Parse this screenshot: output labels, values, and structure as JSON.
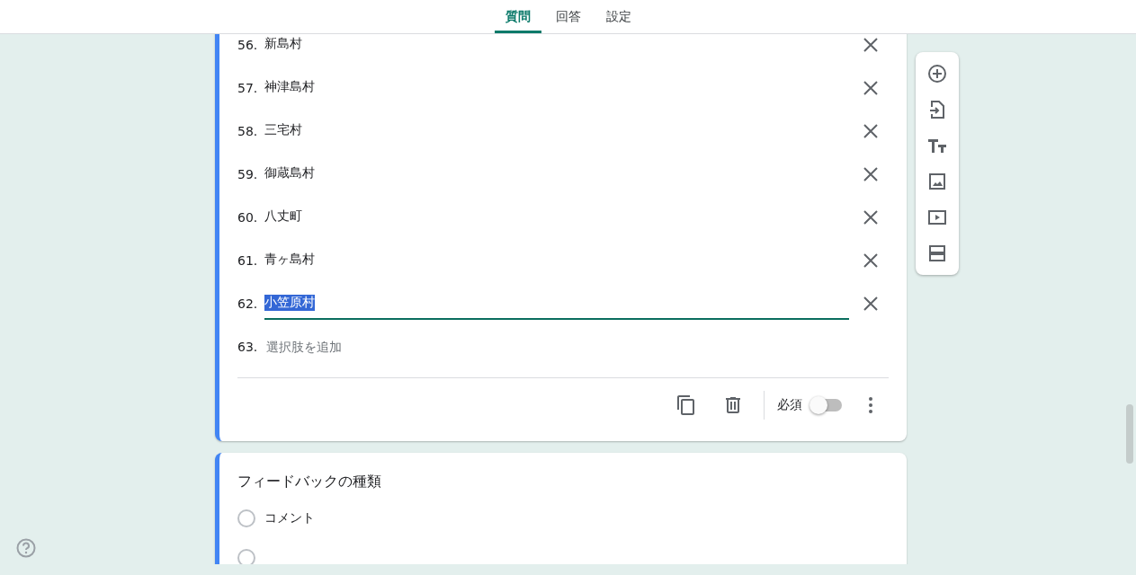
{
  "tabs": [
    {
      "label": "質問",
      "selected": true
    },
    {
      "label": "回答",
      "selected": false
    },
    {
      "label": "設定",
      "selected": false
    }
  ],
  "question": {
    "options": [
      {
        "number": "56.",
        "text": "新島村",
        "editing": false
      },
      {
        "number": "57.",
        "text": "神津島村",
        "editing": false
      },
      {
        "number": "58.",
        "text": "三宅村",
        "editing": false
      },
      {
        "number": "59.",
        "text": "御蔵島村",
        "editing": false
      },
      {
        "number": "60.",
        "text": "八丈町",
        "editing": false
      },
      {
        "number": "61.",
        "text": "青ヶ島村",
        "editing": false
      },
      {
        "number": "62.",
        "text": "小笠原村",
        "editing": true
      }
    ],
    "add_option": {
      "number": "63.",
      "placeholder": "選択肢を追加"
    },
    "required_label": "必須",
    "required": false
  },
  "next_question": {
    "title": "フィードバックの種類",
    "options": [
      {
        "label": "コメント",
        "selected": false
      },
      {
        "selected": false
      }
    ]
  }
}
